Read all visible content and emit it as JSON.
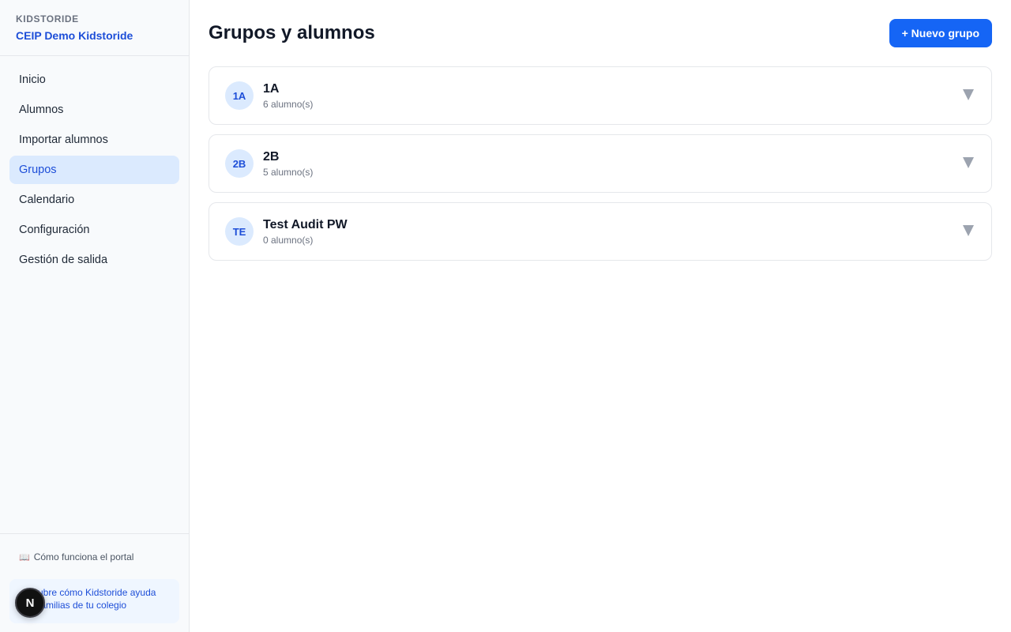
{
  "brand": {
    "kicker": "KIDSTORIDE",
    "school": "CEIP Demo Kidstoride"
  },
  "nav": {
    "items": [
      {
        "label": "Inicio",
        "active": false
      },
      {
        "label": "Alumnos",
        "active": false
      },
      {
        "label": "Importar alumnos",
        "active": false
      },
      {
        "label": "Grupos",
        "active": true
      },
      {
        "label": "Calendario",
        "active": false
      },
      {
        "label": "Configuración",
        "active": false
      },
      {
        "label": "Gestión de salida",
        "active": false
      }
    ]
  },
  "footer": {
    "help_icon": "book-icon",
    "help_label": "Cómo funciona el portal",
    "promo_line1": "ubre cómo Kidstoride ayuda",
    "promo_line2": "familias de tu colegio",
    "badge_letter": "N"
  },
  "main": {
    "title": "Grupos y alumnos",
    "new_group_label": "+ Nuevo grupo",
    "groups": [
      {
        "initials": "1A",
        "name": "1A",
        "count": "6 alumno(s)"
      },
      {
        "initials": "2B",
        "name": "2B",
        "count": "5 alumno(s)"
      },
      {
        "initials": "TE",
        "name": "Test Audit PW",
        "count": "0 alumno(s)"
      }
    ]
  },
  "colors": {
    "accent": "#1565f5",
    "brand_text": "#1d4ed8",
    "active_nav_bg": "#dbeafe"
  }
}
